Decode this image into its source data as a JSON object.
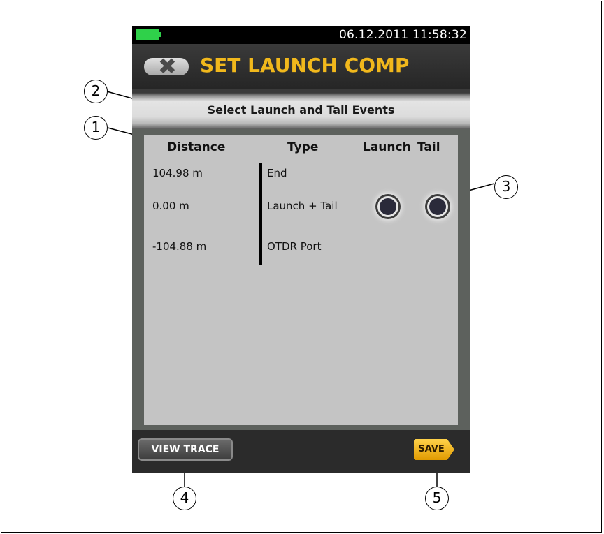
{
  "status_bar": {
    "datetime": "06.12.2011 11:58:32"
  },
  "header": {
    "title": "SET LAUNCH COMP"
  },
  "subheader": {
    "title": "Select Launch and Tail Events"
  },
  "table": {
    "columns": [
      "Distance",
      "Type",
      "Launch",
      "Tail"
    ],
    "rows": [
      {
        "distance": "104.98 m",
        "type": "End",
        "launch_selected": false,
        "tail_selected": false
      },
      {
        "distance": "0.00 m",
        "type": "Launch + Tail",
        "launch_selected": true,
        "tail_selected": true
      },
      {
        "distance": "-104.88 m",
        "type": "OTDR Port",
        "launch_selected": false,
        "tail_selected": false
      }
    ]
  },
  "footer": {
    "view_trace_label": "VIEW TRACE",
    "save_label": "SAVE"
  },
  "callouts": [
    "1",
    "2",
    "3",
    "4",
    "5"
  ],
  "colors": {
    "title": "#f1b81c",
    "battery": "#2fd14a",
    "save": "#f0b400"
  },
  "icons": {
    "back": "close-x-icon",
    "battery": "battery-icon"
  }
}
